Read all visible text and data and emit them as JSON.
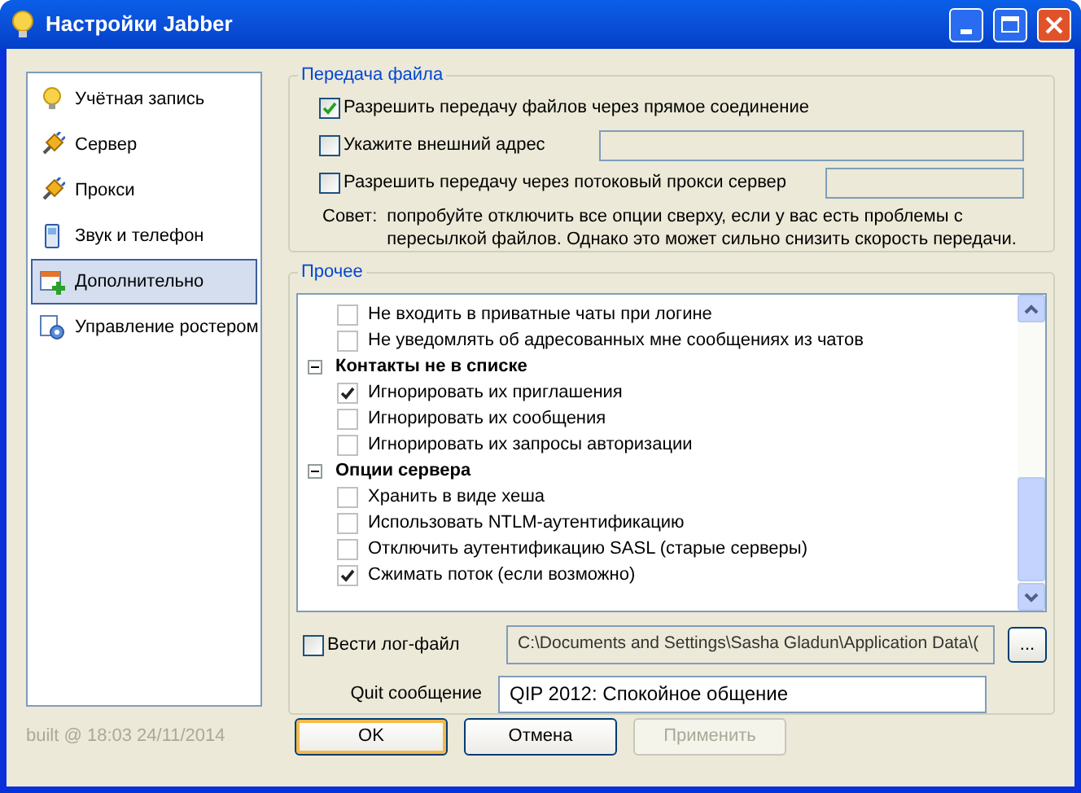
{
  "window": {
    "title": "Настройки Jabber"
  },
  "sidebar": {
    "items": [
      {
        "label": "Учётная запись",
        "selected": false
      },
      {
        "label": "Сервер",
        "selected": false
      },
      {
        "label": "Прокси",
        "selected": false
      },
      {
        "label": "Звук и телефон",
        "selected": false
      },
      {
        "label": "Дополнительно",
        "selected": true
      },
      {
        "label": "Управление ростером",
        "selected": false
      }
    ]
  },
  "file_transfer": {
    "title": "Передача файла",
    "options": [
      {
        "label": "Разрешить передачу файлов через прямое соединение",
        "checked": true,
        "kind": "plain"
      },
      {
        "label": "Укажите внешний адрес",
        "checked": false,
        "kind": "wide_field"
      },
      {
        "label": "Разрешить передачу через потоковый прокси сервер",
        "checked": false,
        "kind": "short_field"
      }
    ],
    "tip": {
      "label": "Совет:",
      "text": "попробуйте отключить все опции сверху, если у вас есть проблемы с пересылкой файлов. Однако это может сильно снизить скорость передачи."
    }
  },
  "other": {
    "title": "Прочее",
    "items": [
      {
        "kind": "option",
        "label": "Не входить в приватные чаты при логине",
        "checked": false
      },
      {
        "kind": "option",
        "label": "Не уведомлять об адресованных мне сообщениях из чатов",
        "checked": false
      },
      {
        "kind": "group",
        "label": "Контакты не в списке",
        "expanded": true,
        "children": [
          {
            "kind": "option",
            "label": "Игнорировать их приглашения",
            "checked": true
          },
          {
            "kind": "option",
            "label": "Игнорировать их сообщения",
            "checked": false
          },
          {
            "kind": "option",
            "label": "Игнорировать их запросы авторизации",
            "checked": false
          }
        ]
      },
      {
        "kind": "group",
        "label": "Опции сервера",
        "expanded": true,
        "children": [
          {
            "kind": "option",
            "label": "Хранить в виде хеша",
            "checked": false
          },
          {
            "kind": "option",
            "label": "Использовать NTLM-аутентификацию",
            "checked": false
          },
          {
            "kind": "option",
            "label": "Отключить аутентификацию SASL (старые серверы)",
            "checked": false
          },
          {
            "kind": "option",
            "label": "Сжимать поток (если возможно)",
            "checked": true
          }
        ]
      }
    ],
    "log": {
      "label": "Вести лог-файл",
      "checked": false,
      "value": "C:\\Documents and Settings\\Sasha Gladun\\Application Data\\(",
      "disabled": true,
      "browse": "..."
    },
    "quit": {
      "label": "Quit сообщение",
      "value": "QIP 2012: Спокойное общение"
    }
  },
  "build_info": "built @ 18:03 24/11/2014",
  "buttons": [
    {
      "label": "OK",
      "kind": "default",
      "disabled": false
    },
    {
      "label": "Отмена",
      "kind": "normal",
      "disabled": false
    },
    {
      "label": "Применить",
      "kind": "normal",
      "disabled": true
    }
  ]
}
